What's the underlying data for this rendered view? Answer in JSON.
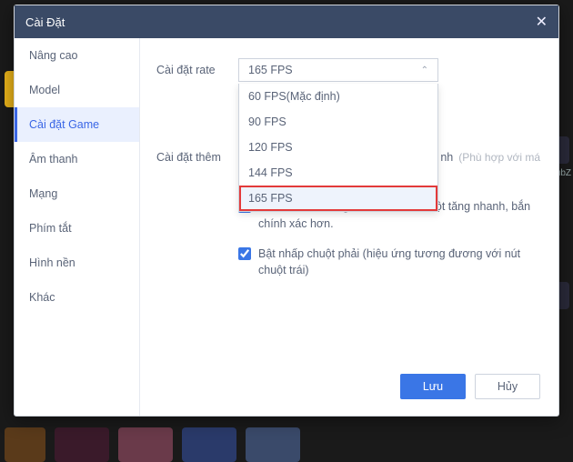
{
  "titlebar": {
    "title": "Cài Đặt"
  },
  "sidebar": {
    "items": [
      {
        "label": "Nâng cao"
      },
      {
        "label": "Model"
      },
      {
        "label": "Cài đặt Game",
        "active": true
      },
      {
        "label": "Âm thanh"
      },
      {
        "label": "Mạng"
      },
      {
        "label": "Phím tắt"
      },
      {
        "label": "Hình nền"
      },
      {
        "label": "Khác"
      }
    ]
  },
  "main": {
    "rate_label": "Cài đặt rate",
    "rate_value": "165 FPS",
    "rate_options": [
      {
        "label": "60  FPS(Mặc định)"
      },
      {
        "label": "90 FPS"
      },
      {
        "label": "120 FPS"
      },
      {
        "label": "144 FPS"
      },
      {
        "label": "165 FPS",
        "highlight": true,
        "hover": true
      }
    ],
    "extra_label": "Cài đặt thêm",
    "extra_fragment_right": "nh",
    "extra_hint": "(Phù hợp với má",
    "check_pubg": "Ở PUBG, tự động tắt Windows chuột tăng nhanh, bắn chính xác hơn.",
    "check_rightclick": "Bật nhấp chuột phải (hiệu ứng tương đương với nút chuột trái)",
    "subz_label": "SubZ"
  },
  "footer": {
    "save": "Lưu",
    "cancel": "Hủy"
  }
}
